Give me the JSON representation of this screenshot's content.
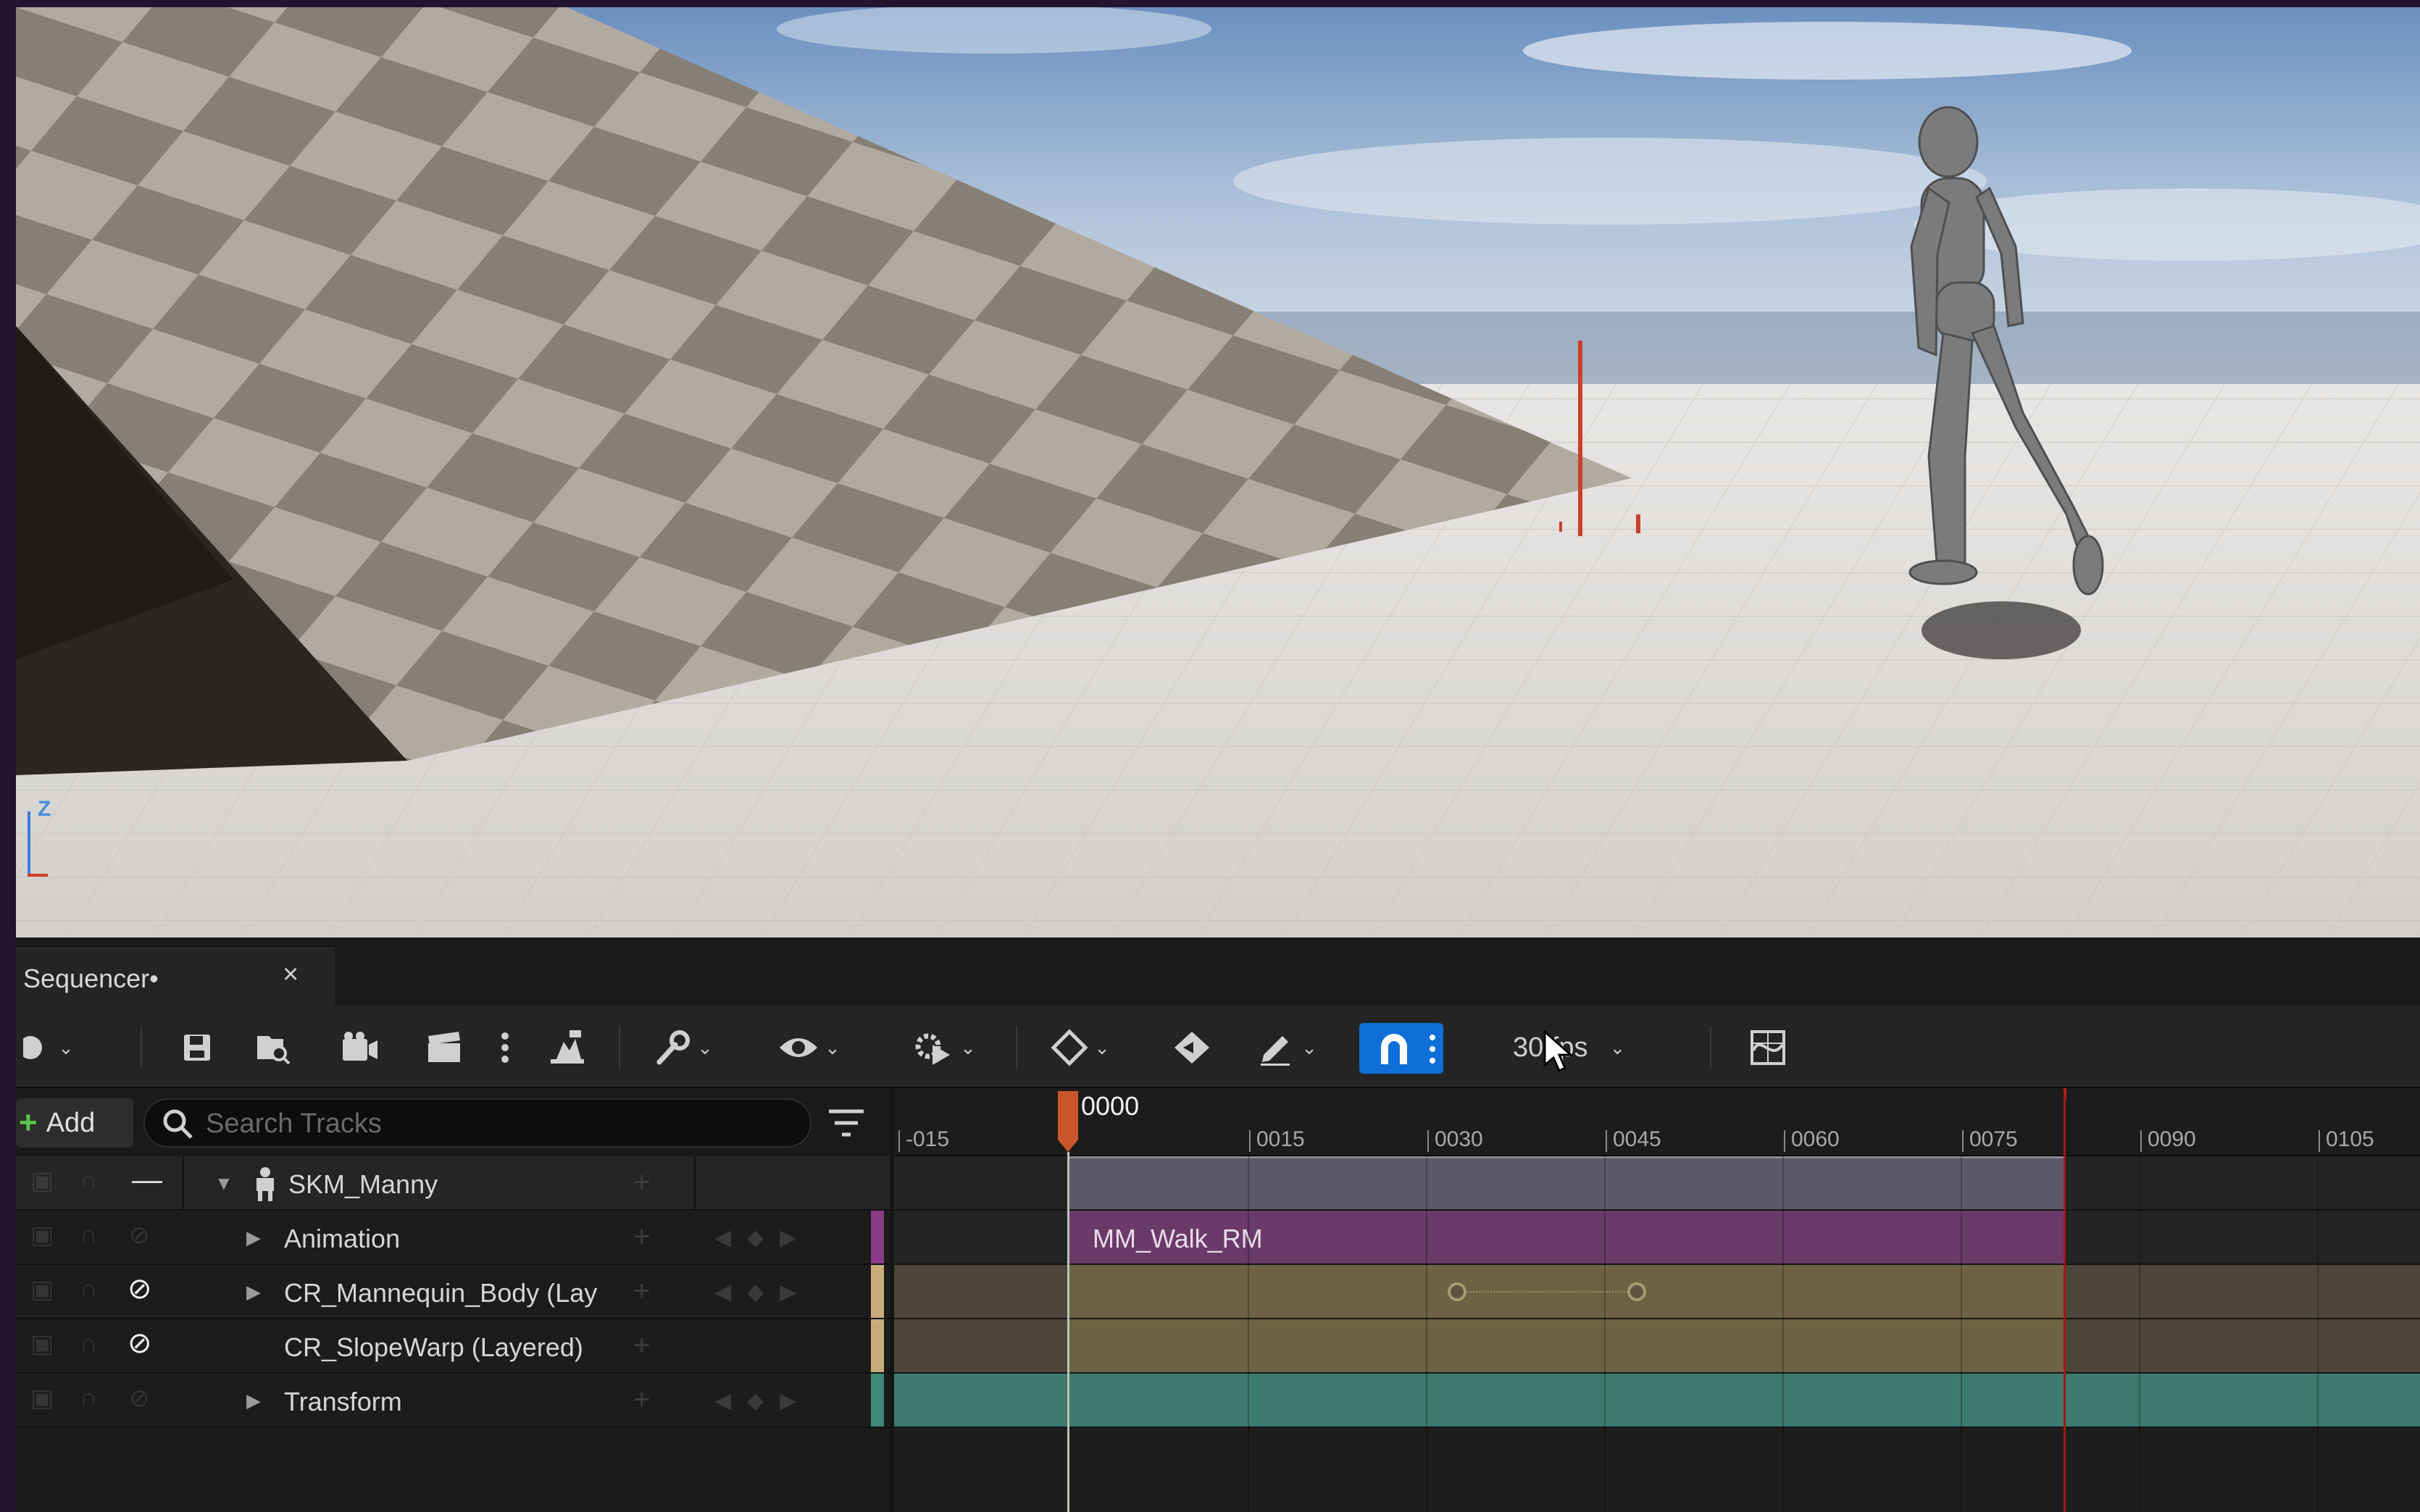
{
  "viewport": {
    "axis_label": "Z"
  },
  "sequencer": {
    "tab_title": "Sequencer•",
    "tab_close": "×",
    "toolbar": {
      "fps_label": "30 fps",
      "snap_enabled": true,
      "accent_color": "#0f6fd8"
    },
    "add_label": "Add",
    "search_placeholder": "Search Tracks",
    "tracks": [
      {
        "label": "SKM_Manny",
        "level": 0,
        "expanded": true,
        "icon": "skeletal-mesh-icon"
      },
      {
        "label": "Animation",
        "level": 1,
        "expanded": false
      },
      {
        "label": "CR_Mannequin_Body (Lay",
        "level": 1,
        "expanded": false,
        "disabled_toggle": true
      },
      {
        "label": "CR_SlopeWarp (Layered)",
        "level": 1,
        "expanded": false,
        "disabled_toggle": true
      },
      {
        "label": "Transform",
        "level": 1,
        "expanded": false
      }
    ],
    "timeline": {
      "playhead_frame": "0000",
      "ruler_ticks": [
        "-015",
        "0015",
        "0030",
        "0045",
        "0060",
        "0075",
        "0090",
        "0105"
      ],
      "animation_section": "MM_Walk_RM"
    }
  }
}
